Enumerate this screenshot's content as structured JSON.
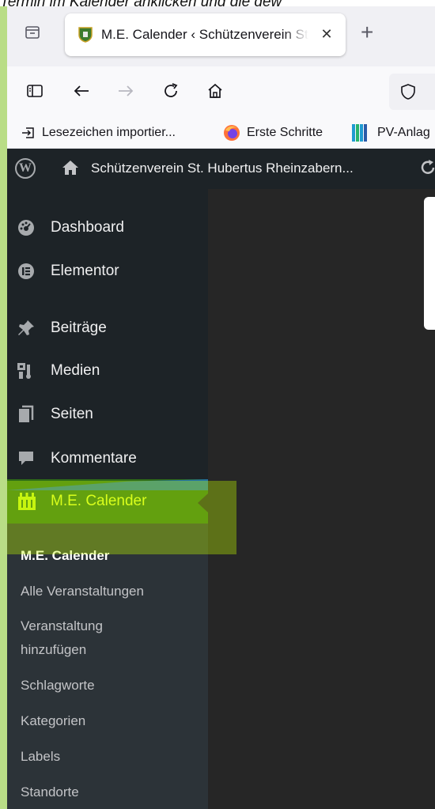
{
  "caption": "Termin im Kalender anklicken und die gew",
  "browser": {
    "tab": {
      "title": "M.E. Calender ‹ Schützenverein St. Hubertus Rheinzabern",
      "close": "✕"
    },
    "new_tab": "+",
    "bookmarks": [
      {
        "label": "Lesezeichen importier...",
        "icon": "import-icon"
      },
      {
        "label": "Erste Schritte",
        "icon": "firefox-icon"
      },
      {
        "label": "PV-Anlag",
        "icon": "pv-chart-icon"
      }
    ]
  },
  "wp_admin_bar": {
    "site_name": "Schützenverein St. Hubertus Rheinzabern..."
  },
  "sidebar": {
    "items": [
      {
        "label": "Dashboard",
        "icon": "dashboard-icon"
      },
      {
        "label": "Elementor",
        "icon": "elementor-icon"
      },
      {
        "label": "Beiträge",
        "icon": "pin-icon"
      },
      {
        "label": "Medien",
        "icon": "media-icon"
      },
      {
        "label": "Seiten",
        "icon": "pages-icon"
      },
      {
        "label": "Kommentare",
        "icon": "comments-icon"
      },
      {
        "label": "M.E. Calender",
        "icon": "calendar-icon",
        "active": true
      }
    ],
    "submenu": [
      {
        "label": "M.E. Calender",
        "current": true
      },
      {
        "label": "Alle Veranstaltungen"
      },
      {
        "label": "Veranstaltung"
      },
      {
        "label": "hinzufügen"
      },
      {
        "label": "Schlagworte"
      },
      {
        "label": "Kategorien"
      },
      {
        "label": "Labels"
      },
      {
        "label": "Standorte"
      }
    ]
  },
  "colors": {
    "admin_bg": "#1d2327",
    "submenu_bg": "#2c3338",
    "highlight": "#c6ff00",
    "active_text": "#e3ff2b"
  }
}
